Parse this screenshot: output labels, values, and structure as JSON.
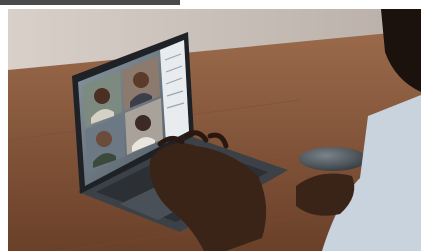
{
  "photo": {
    "subject": "laptop-video-call",
    "colors": {
      "frame_bar": "#4a4a4a",
      "frame_bar_light": "#d9d9d9",
      "wall": "#cfc6bf",
      "table": "#8a5a3e",
      "table_dark": "#5e3a26",
      "laptop_body": "#3c4147",
      "laptop_screen_bezel": "#1e2126",
      "video_bg": "#6f7c86",
      "sidebar": "#e8ecef",
      "mouse": "#4b5258",
      "skin": "#3a2418",
      "shirt": "#c9d3de"
    },
    "icons": [
      "video-call-participant",
      "mouse"
    ]
  }
}
